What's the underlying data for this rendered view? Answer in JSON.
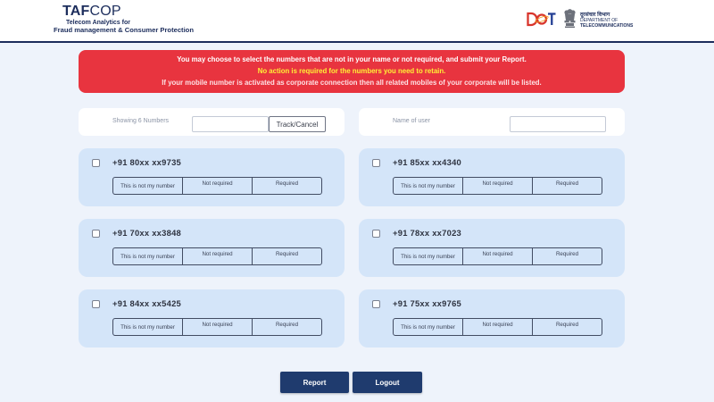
{
  "header": {
    "logo_part1": "TAF",
    "logo_part2": "COP",
    "tagline_line1": "Telecom Analytics for",
    "tagline_line2": "Fraud management & Consumer Protection",
    "dot_logo_lettering": "DOT",
    "department_hindi": "दूरसंचार विभाग",
    "department_line1": "DEPARTMENT OF",
    "department_line2": "TELECOMMUNICATIONS"
  },
  "notice": {
    "line1": "You may choose to select the numbers that are not in your name or not required, and submit your Report.",
    "line2": "No action is required for the numbers you need to retain.",
    "line3": "If your mobile number is activated as corporate connection then all related mobiles of your corporate will be listed."
  },
  "filters": {
    "count_label": "Showing 6 Numbers",
    "track_input_value": "",
    "track_button_label": "Track/Cancel",
    "name_label": "Name of user",
    "name_input_value": ""
  },
  "numbers": [
    {
      "number": "+91 80xx xx9735"
    },
    {
      "number": "+91 85xx xx4340"
    },
    {
      "number": "+91 70xx xx3848"
    },
    {
      "number": "+91 78xx xx7023"
    },
    {
      "number": "+91 84xx xx5425"
    },
    {
      "number": "+91 75xx xx9765"
    }
  ],
  "options": [
    "This is not my number",
    "Not required",
    "Required"
  ],
  "actions": {
    "report_label": "Report",
    "logout_label": "Logout"
  },
  "colors": {
    "brand_navy": "#1c2d5c",
    "notice_red": "#e8343f",
    "notice_highlight": "#fff036",
    "card_blue": "#d4e5f9",
    "page_background": "#eef3fb",
    "button_navy": "#1f3b6e"
  }
}
